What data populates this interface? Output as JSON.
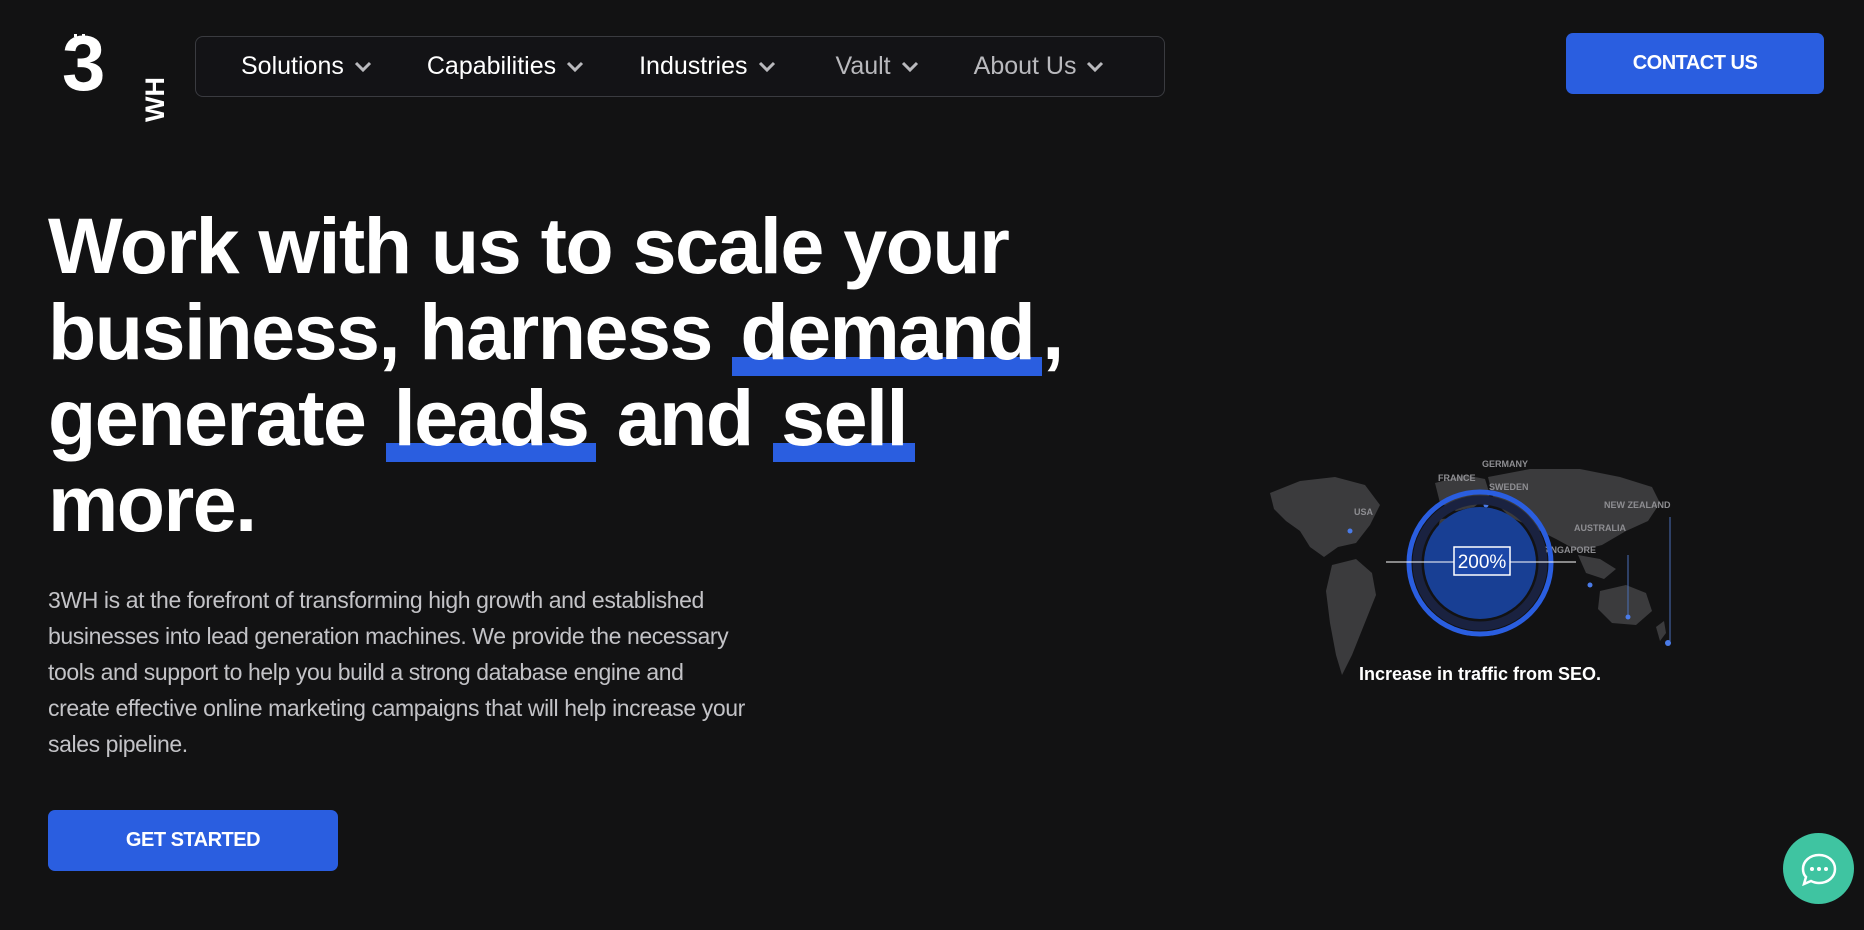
{
  "logo": {
    "big": "3",
    "small": "WH"
  },
  "nav": {
    "items": [
      {
        "label": "Solutions"
      },
      {
        "label": "Capabilities"
      },
      {
        "label": "Industries"
      },
      {
        "label": "Vault"
      },
      {
        "label": "About Us"
      }
    ]
  },
  "header": {
    "contact_label": "CONTACT US"
  },
  "hero": {
    "title_part1": "Work with us to scale your business, harness",
    "title_hl1": "demand",
    "title_part2": ", generate",
    "title_hl2": "leads",
    "title_part3": "and",
    "title_hl3": "sell",
    "title_part4": "more.",
    "description": "3WH is at the forefront of transforming high growth and established businesses into lead generation machines. We provide the necessary tools and support to help you build a strong database engine and create effective online marketing campaigns that will help increase your sales pipeline.",
    "cta_label": "GET STARTED"
  },
  "map": {
    "labels": [
      "GERMANY",
      "FRANCE",
      "SWEDEN",
      "USA",
      "NEW ZEALAND",
      "AUSTRALIA",
      "SINGAPORE"
    ],
    "stat": "200%",
    "caption": "Increase in traffic from SEO."
  },
  "colors": {
    "accent": "#2a5ee0",
    "background": "#121213",
    "chat": "#3fc4a1"
  },
  "icons": {
    "chevron": "chevron-down-icon",
    "chat": "chat-bubble-icon"
  }
}
